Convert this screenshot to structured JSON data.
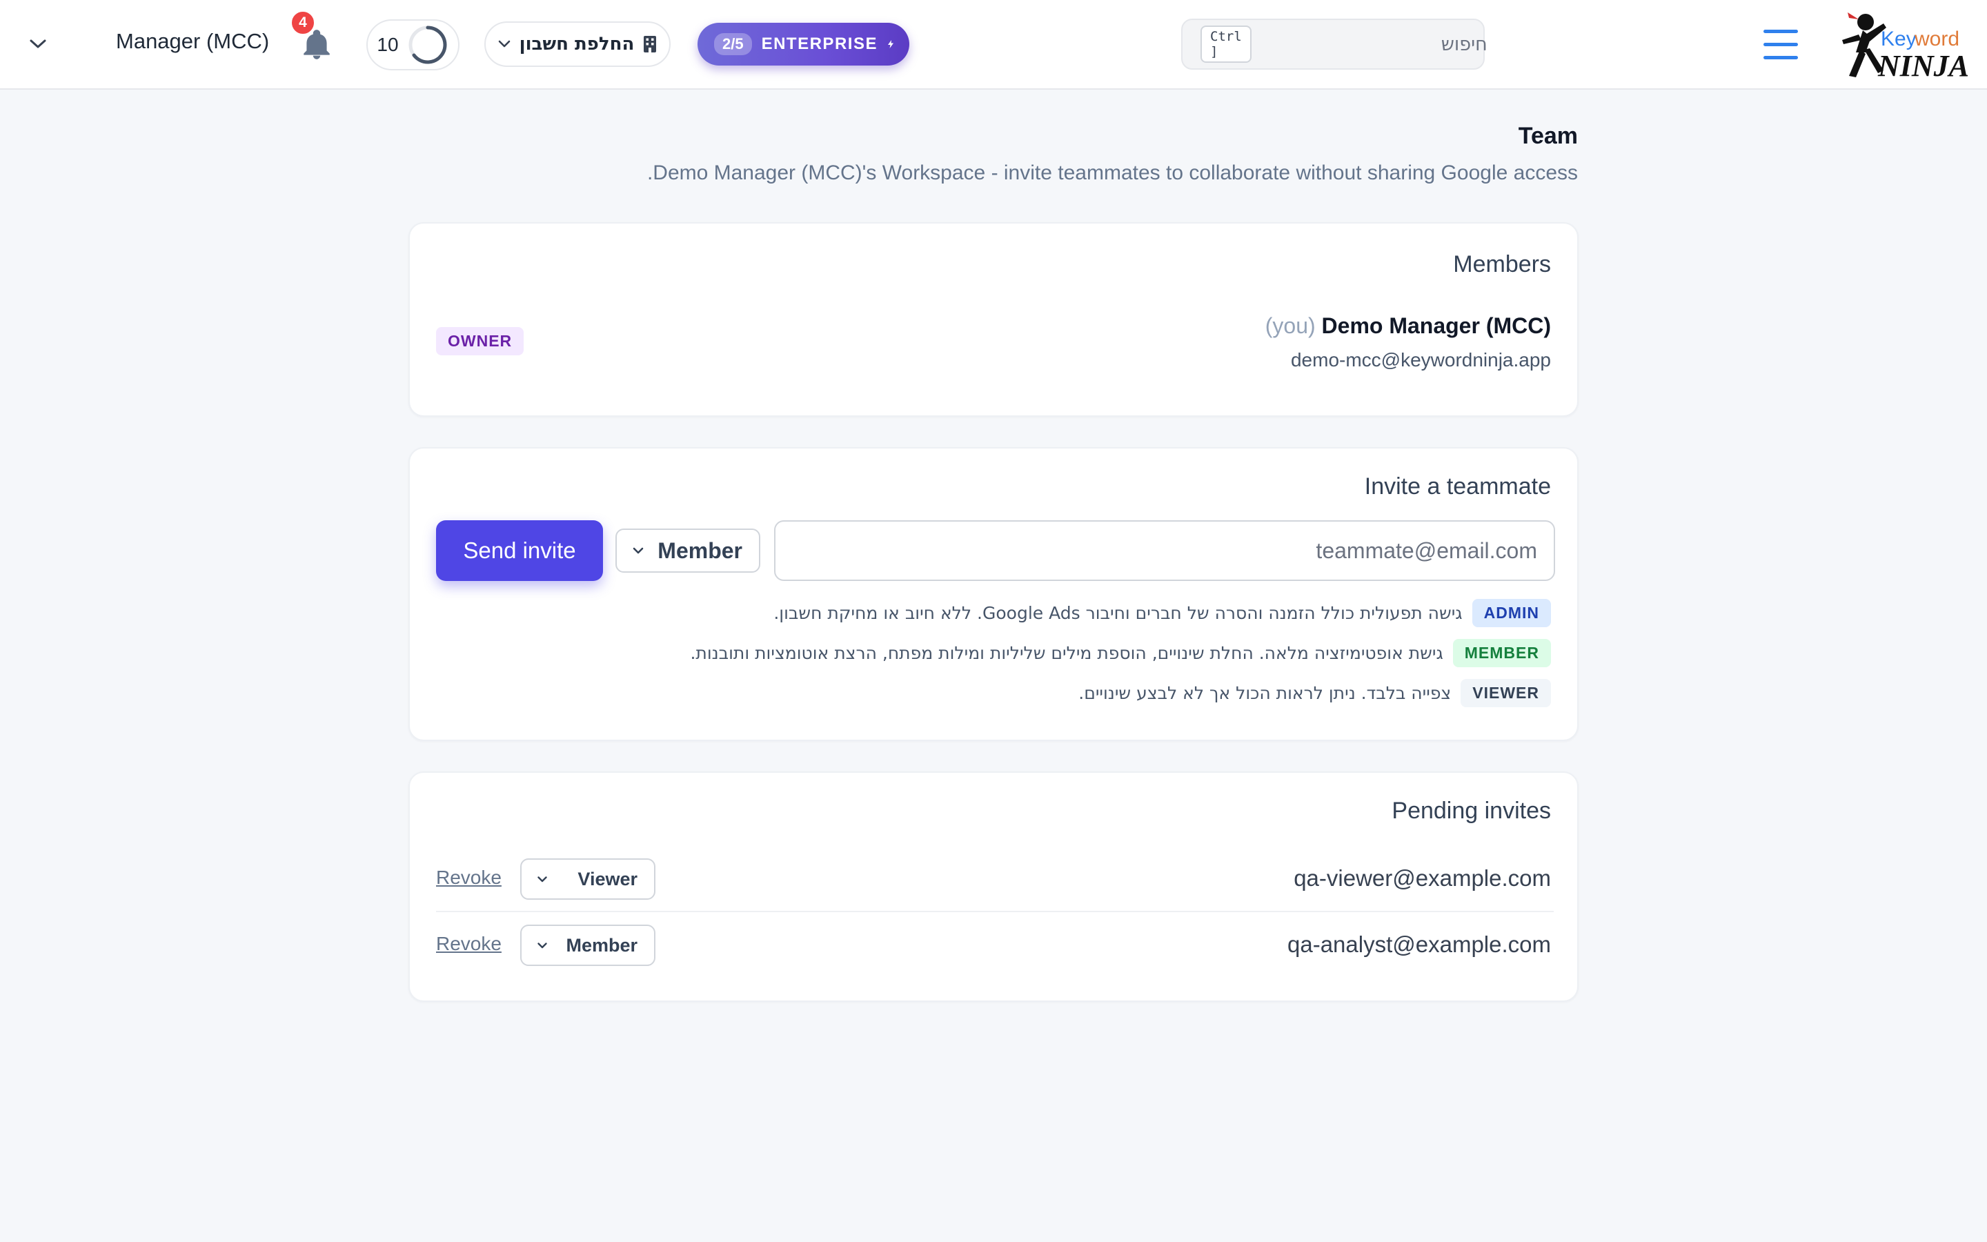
{
  "header": {
    "user_name": "Manager (MCC)",
    "notification_count": "4",
    "credits": "10",
    "switch_account_label": "החלפת חשבון",
    "plan": {
      "count": "2/5",
      "label": "ENTERPRISE"
    },
    "search": {
      "placeholder": "חיפוש",
      "shortcut": "Ctrl ]"
    },
    "logo_text_top": "Keyword",
    "logo_text_bottom": "NINJA"
  },
  "page": {
    "title": "Team",
    "subtitle": ".Demo Manager (MCC)'s Workspace - invite teammates to collaborate without sharing Google access"
  },
  "members": {
    "title": "Members",
    "items": [
      {
        "name": "Demo Manager (MCC)",
        "you": "(you)",
        "email": "demo-mcc@keywordninja.app",
        "role": "OWNER"
      }
    ]
  },
  "invite": {
    "title": "Invite a teammate",
    "email_placeholder": "teammate@email.com",
    "role_selected": "Member",
    "send_label": "Send invite",
    "roles": [
      {
        "badge": "ADMIN",
        "desc": "גישה תפעולית כולל הזמנה והסרה של חברים וחיבור Google Ads. ללא חיוב או מחיקת חשבון."
      },
      {
        "badge": "MEMBER",
        "desc": "גישת אופטימיזציה מלאה. החלת שינויים, הוספת מילים שליליות ומילות מפתח, הרצת אוטומציות ותובנות."
      },
      {
        "badge": "VIEWER",
        "desc": "צפייה בלבד. ניתן לראות הכול אך לא לבצע שינויים."
      }
    ]
  },
  "pending": {
    "title": "Pending invites",
    "revoke_label": "Revoke",
    "items": [
      {
        "email": "qa-viewer@example.com",
        "role": "Viewer"
      },
      {
        "email": "qa-analyst@example.com",
        "role": "Member"
      }
    ]
  },
  "colors": {
    "accent": "#4f46e5",
    "plan_gradient_start": "#6f6ad8",
    "plan_gradient_end": "#5b3cc4",
    "badge_red": "#ef4444",
    "menu_blue": "#2f80ed"
  }
}
